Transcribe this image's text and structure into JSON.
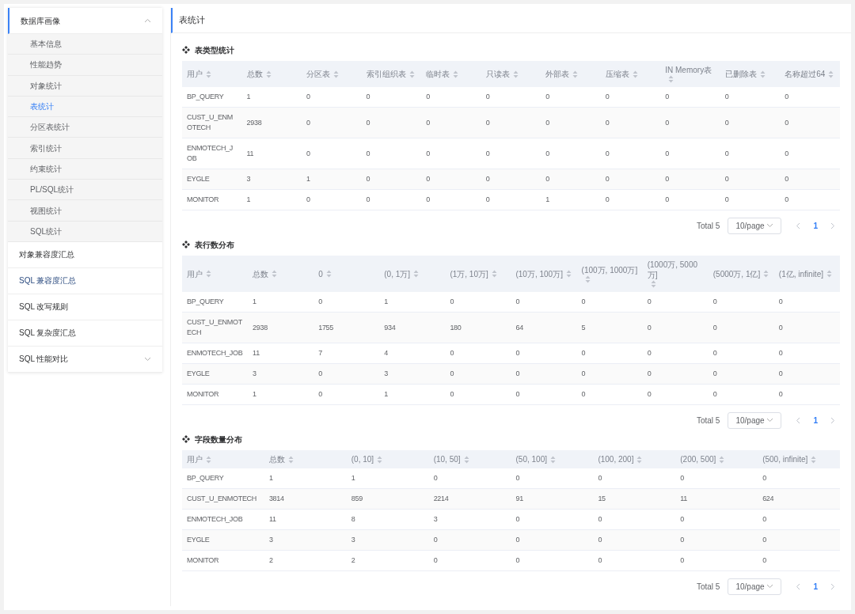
{
  "sidebar": {
    "items": [
      {
        "label": "数据库画像",
        "expanded": true,
        "highlighted": false,
        "children": [
          {
            "label": "基本信息",
            "selected": false
          },
          {
            "label": "性能趋势",
            "selected": false
          },
          {
            "label": "对象统计",
            "selected": false
          },
          {
            "label": "表统计",
            "selected": true
          },
          {
            "label": "分区表统计",
            "selected": false
          },
          {
            "label": "索引统计",
            "selected": false
          },
          {
            "label": "约束统计",
            "selected": false
          },
          {
            "label": "PL/SQL统计",
            "selected": false
          },
          {
            "label": "视图统计",
            "selected": false
          },
          {
            "label": "SQL统计",
            "selected": false
          }
        ]
      },
      {
        "label": "对象兼容度汇总",
        "highlighted": false
      },
      {
        "label": "SQL 兼容度汇总",
        "highlighted": true
      },
      {
        "label": "SQL 改写规则",
        "highlighted": false
      },
      {
        "label": "SQL 复杂度汇总",
        "highlighted": false
      },
      {
        "label": "SQL 性能对比",
        "expanded": false,
        "highlighted": false
      }
    ]
  },
  "main": {
    "title": "表统计",
    "sections": [
      {
        "title": "表类型统计",
        "columns": [
          "用户",
          "总数",
          "分区表",
          "索引组织表",
          "临时表",
          "只读表",
          "外部表",
          "压缩表",
          "IN Memory表",
          "已删除表",
          "名称超过64"
        ],
        "rows": [
          [
            "BP_QUERY",
            "1",
            "0",
            "0",
            "0",
            "0",
            "0",
            "0",
            "0",
            "0",
            "0"
          ],
          [
            "CUST_U_ENMOTECH",
            "2938",
            "0",
            "0",
            "0",
            "0",
            "0",
            "0",
            "0",
            "0",
            "0"
          ],
          [
            "ENMOTECH_JOB",
            "11",
            "0",
            "0",
            "0",
            "0",
            "0",
            "0",
            "0",
            "0",
            "0"
          ],
          [
            "EYGLE",
            "3",
            "1",
            "0",
            "0",
            "0",
            "0",
            "0",
            "0",
            "0",
            "0"
          ],
          [
            "MONITOR",
            "1",
            "0",
            "0",
            "0",
            "0",
            "1",
            "0",
            "0",
            "0",
            "0"
          ]
        ],
        "pagination": {
          "total": "Total 5",
          "page_size": "10/page",
          "pages": [
            {
              "label": "1",
              "selected": true
            }
          ]
        }
      },
      {
        "title": "表行数分布",
        "columns": [
          "用户",
          "总数",
          "0",
          "(0, 1万]",
          "(1万, 10万]",
          "(10万, 100万]",
          "(100万, 1000万]",
          "(1000万, 5000万]",
          "(5000万, 1亿]",
          "(1亿, infinite]"
        ],
        "rows": [
          [
            "BP_QUERY",
            "1",
            "0",
            "1",
            "0",
            "0",
            "0",
            "0",
            "0",
            "0"
          ],
          [
            "CUST_U_ENMOTECH",
            "2938",
            "1755",
            "934",
            "180",
            "64",
            "5",
            "0",
            "0",
            "0"
          ],
          [
            "ENMOTECH_JOB",
            "11",
            "7",
            "4",
            "0",
            "0",
            "0",
            "0",
            "0",
            "0"
          ],
          [
            "EYGLE",
            "3",
            "0",
            "3",
            "0",
            "0",
            "0",
            "0",
            "0",
            "0"
          ],
          [
            "MONITOR",
            "1",
            "0",
            "1",
            "0",
            "0",
            "0",
            "0",
            "0",
            "0"
          ]
        ],
        "pagination": {
          "total": "Total 5",
          "page_size": "10/page",
          "pages": [
            {
              "label": "1",
              "selected": true
            }
          ]
        }
      },
      {
        "title": "字段数量分布",
        "columns": [
          "用户",
          "总数",
          "(0, 10]",
          "(10, 50]",
          "(50, 100]",
          "(100, 200]",
          "(200, 500]",
          "(500, infinite]"
        ],
        "rows": [
          [
            "BP_QUERY",
            "1",
            "1",
            "0",
            "0",
            "0",
            "0",
            "0"
          ],
          [
            "CUST_U_ENMOTECH",
            "3814",
            "859",
            "2214",
            "91",
            "15",
            "11",
            "624"
          ],
          [
            "ENMOTECH_JOB",
            "11",
            "8",
            "3",
            "0",
            "0",
            "0",
            "0"
          ],
          [
            "EYGLE",
            "3",
            "3",
            "0",
            "0",
            "0",
            "0",
            "0"
          ],
          [
            "MONITOR",
            "2",
            "2",
            "0",
            "0",
            "0",
            "0",
            "0"
          ]
        ],
        "pagination": {
          "total": "Total 5",
          "page_size": "10/page",
          "pages": [
            {
              "label": "1",
              "selected": true
            }
          ]
        }
      }
    ]
  }
}
